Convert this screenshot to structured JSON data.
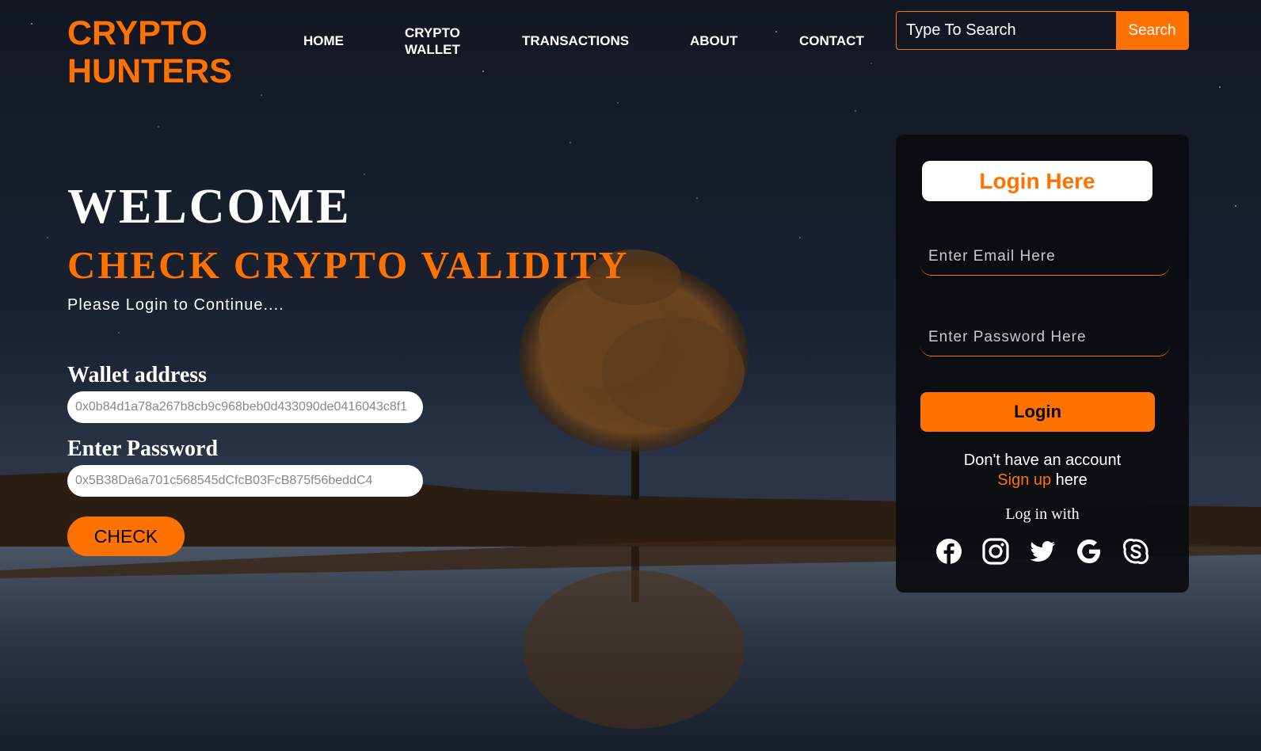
{
  "brand": {
    "line1": "CRYPTO",
    "line2": "HUNTERS",
    "color": "#ff7200"
  },
  "nav": {
    "home": "HOME",
    "crypto_wallet_1": "CRYPTO",
    "crypto_wallet_2": "WALLET",
    "transactions": "TRANSACTIONS",
    "about": "ABOUT",
    "contact": "CONTACT"
  },
  "search": {
    "placeholder": "Type To Search",
    "button": "Search"
  },
  "hero": {
    "welcome": "WELCOME",
    "subtitle": "CHECK CRYPTO VALIDITY",
    "prompt": "Please Login to Continue...."
  },
  "check_form": {
    "wallet_label": "Wallet address",
    "wallet_value": "0x0b84d1a78a267b8cb9c968beb0d433090de0416043c8f1",
    "password_label": "Enter Password",
    "password_value": "0x5B38Da6a701c568545dCfcB03FcB875f56beddC4",
    "check_button": "CHECK"
  },
  "login": {
    "title": "Login Here",
    "email_placeholder": "Enter Email Here",
    "password_placeholder": "Enter Password Here",
    "button": "Login",
    "no_account": "Don't have an account",
    "signup_link": "Sign up",
    "signup_suffix": " here",
    "login_with": "Log in with",
    "socials": [
      "facebook-icon",
      "instagram-icon",
      "twitter-icon",
      "google-icon",
      "skype-icon"
    ]
  }
}
